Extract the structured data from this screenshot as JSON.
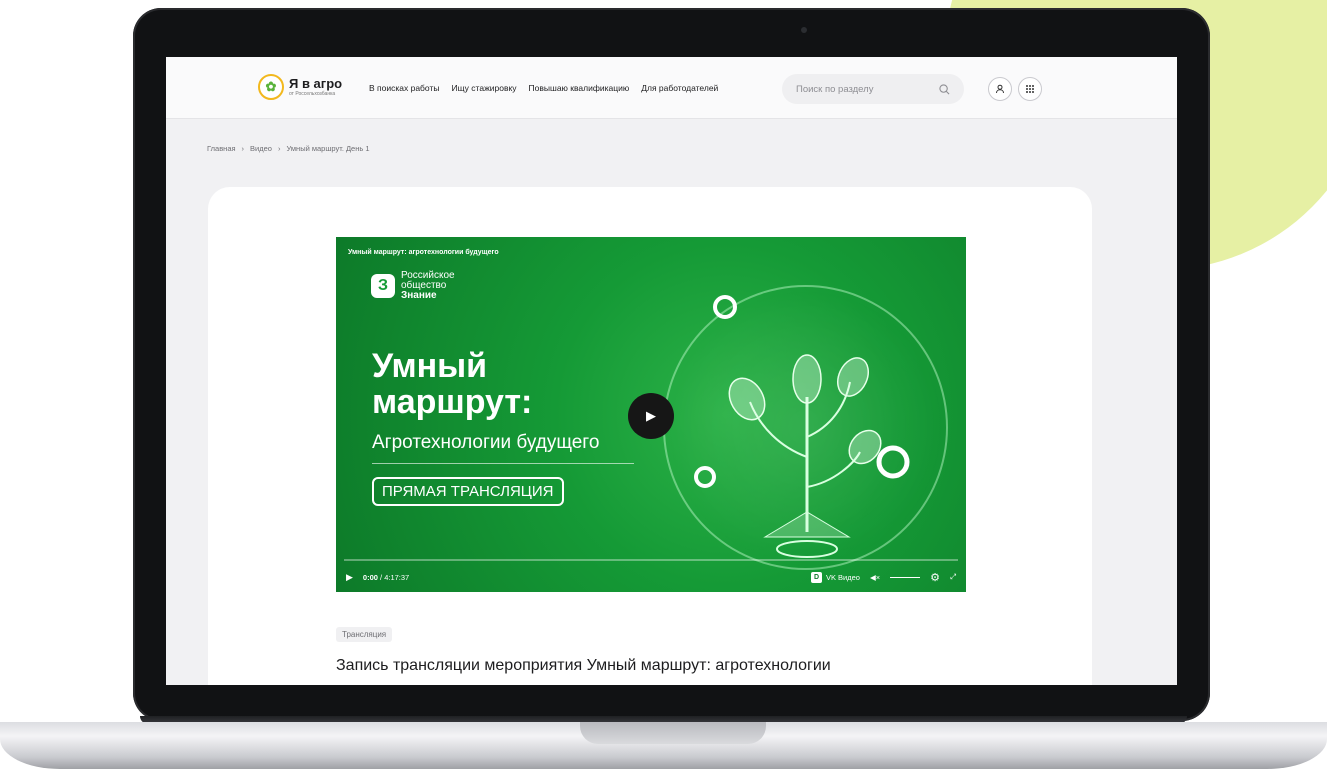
{
  "header": {
    "logo_name": "Я в агро",
    "logo_sub": "от Россельхозбанка",
    "nav": [
      "В поисках работы",
      "Ищу стажировку",
      "Повышаю квалификацию",
      "Для работодателей"
    ],
    "search_placeholder": "Поиск по разделу",
    "icons": {
      "search": "search-icon",
      "profile": "user-icon",
      "menu": "grid-menu-icon"
    }
  },
  "breadcrumb": [
    "Главная",
    "Видео",
    "Умный маршрут. День 1"
  ],
  "breadcrumb_separator": "›",
  "video": {
    "title": "Умный маршрут: агротехнологии будущего",
    "org_lines": [
      "Российское",
      "общество",
      "Знание"
    ],
    "heading_line1": "Умный",
    "heading_line2": "маршрут:",
    "subheading": "Агротехнологии будущего",
    "live_label": "ПРЯМАЯ ТРАНСЛЯЦИЯ",
    "time_current": "0:00",
    "time_total": "4:17:37",
    "provider": "VK Видео",
    "progress": 0
  },
  "tag": "Трансляция",
  "article_title": "Запись трансляции мероприятия Умный маршрут: агротехнологии",
  "colors": {
    "accent_green": "#159a36",
    "deco_lime": "#e6f0a4",
    "logo_yellow": "#f2b81d"
  }
}
